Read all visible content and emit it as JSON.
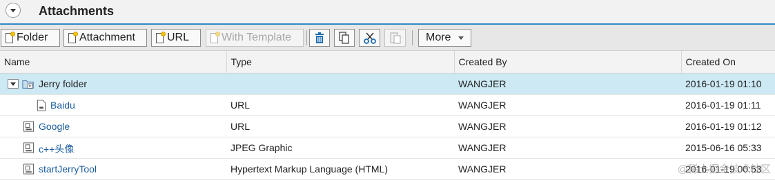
{
  "header": {
    "title": "Attachments"
  },
  "toolbar": {
    "folder_label": "Folder",
    "attachment_label": "Attachment",
    "url_label": "URL",
    "with_template_label": "With Template",
    "more_label": "More"
  },
  "table": {
    "columns": [
      "Name",
      "Type",
      "Created By",
      "Created On"
    ],
    "rows": [
      {
        "name": "Jerry folder",
        "type": "",
        "created_by": "WANGJER",
        "created_on": "2016-01-19 01:10",
        "icon": "folder-icon",
        "level": 0,
        "selected": true
      },
      {
        "name": "Baidu",
        "type": "URL",
        "created_by": "WANGJER",
        "created_on": "2016-01-19 01:11",
        "icon": "document-icon",
        "level": 1
      },
      {
        "name": "Google",
        "type": "URL",
        "created_by": "WANGJER",
        "created_on": "2016-01-19 01:12",
        "icon": "attachment-icon",
        "level": 0
      },
      {
        "name": "c++头像",
        "type": "JPEG Graphic",
        "created_by": "WANGJER",
        "created_on": "2015-06-16 05:33",
        "icon": "attachment-icon",
        "level": 0
      },
      {
        "name": "startJerryTool",
        "type": "Hypertext Markup Language (HTML)",
        "created_by": "WANGJER",
        "created_on": "2016-01-19 00:53",
        "icon": "attachment-icon",
        "level": 0
      }
    ]
  },
  "watermark": "@稀土掘金技术社区",
  "colors": {
    "accent": "#2f89c9",
    "link": "#1b5c9e",
    "selected_row": "#cde9f4"
  }
}
